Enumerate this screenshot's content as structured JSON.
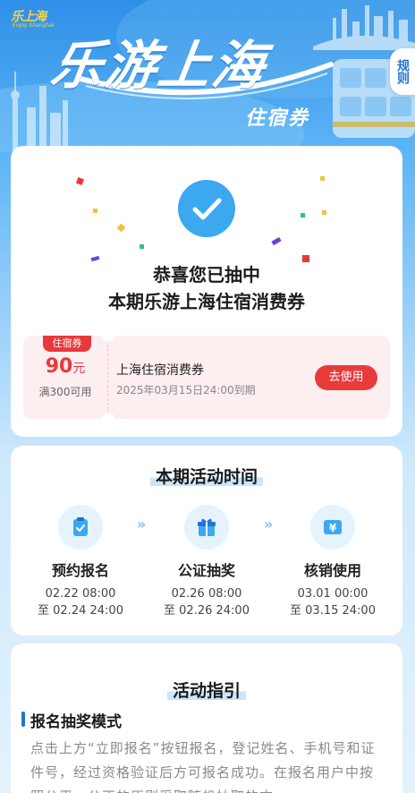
{
  "header": {
    "logo_text": "乐上海",
    "logo_sub": "Enjoy Shanghai",
    "title": "乐游上海",
    "subtitle": "住宿券",
    "rules_button": "规则"
  },
  "result": {
    "line1": "恭喜您已抽中",
    "line2": "本期乐游上海住宿消费券"
  },
  "coupon": {
    "tag": "住宿券",
    "amount": "90",
    "unit": "元",
    "condition": "满300可用",
    "name": "上海住宿消费券",
    "expiry": "2025年03月15日24:00到期",
    "button": "去使用"
  },
  "schedule": {
    "title": "本期活动时间",
    "steps": [
      {
        "label": "预约报名",
        "start": "02.22 08:00",
        "end": "至 02.24 24:00",
        "icon": "clipboard-check-icon"
      },
      {
        "label": "公证抽奖",
        "start": "02.26 08:00",
        "end": "至 02.26 24:00",
        "icon": "gift-icon"
      },
      {
        "label": "核销使用",
        "start": "03.01 00:00",
        "end": "至 03.15 24:00",
        "icon": "yen-ticket-icon"
      }
    ],
    "arrow": "»"
  },
  "guide": {
    "title": "活动指引",
    "section_title": "报名抽奖模式",
    "text": "点击上方“立即报名”按钮报名，登记姓名、手机号和证件号，经过资格验证后方可报名成功。在报名用户中按照公平、公正的原则采取随机抽取的方"
  },
  "colors": {
    "primary_blue": "#1e73d6",
    "accent_red": "#e8383d",
    "coupon_bg": "#fdeef0",
    "check_blue": "#3ca8f0"
  }
}
